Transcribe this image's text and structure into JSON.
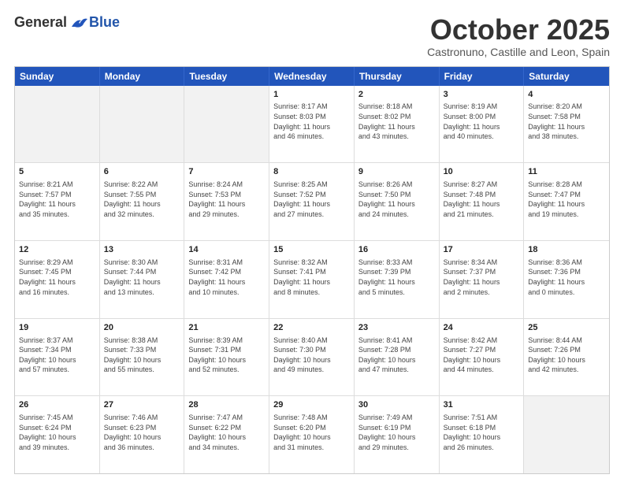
{
  "logo": {
    "general": "General",
    "blue": "Blue"
  },
  "header": {
    "month": "October 2025",
    "location": "Castronuno, Castille and Leon, Spain"
  },
  "days": [
    "Sunday",
    "Monday",
    "Tuesday",
    "Wednesday",
    "Thursday",
    "Friday",
    "Saturday"
  ],
  "rows": [
    [
      {
        "day": "",
        "info": ""
      },
      {
        "day": "",
        "info": ""
      },
      {
        "day": "",
        "info": ""
      },
      {
        "day": "1",
        "info": "Sunrise: 8:17 AM\nSunset: 8:03 PM\nDaylight: 11 hours\nand 46 minutes."
      },
      {
        "day": "2",
        "info": "Sunrise: 8:18 AM\nSunset: 8:02 PM\nDaylight: 11 hours\nand 43 minutes."
      },
      {
        "day": "3",
        "info": "Sunrise: 8:19 AM\nSunset: 8:00 PM\nDaylight: 11 hours\nand 40 minutes."
      },
      {
        "day": "4",
        "info": "Sunrise: 8:20 AM\nSunset: 7:58 PM\nDaylight: 11 hours\nand 38 minutes."
      }
    ],
    [
      {
        "day": "5",
        "info": "Sunrise: 8:21 AM\nSunset: 7:57 PM\nDaylight: 11 hours\nand 35 minutes."
      },
      {
        "day": "6",
        "info": "Sunrise: 8:22 AM\nSunset: 7:55 PM\nDaylight: 11 hours\nand 32 minutes."
      },
      {
        "day": "7",
        "info": "Sunrise: 8:24 AM\nSunset: 7:53 PM\nDaylight: 11 hours\nand 29 minutes."
      },
      {
        "day": "8",
        "info": "Sunrise: 8:25 AM\nSunset: 7:52 PM\nDaylight: 11 hours\nand 27 minutes."
      },
      {
        "day": "9",
        "info": "Sunrise: 8:26 AM\nSunset: 7:50 PM\nDaylight: 11 hours\nand 24 minutes."
      },
      {
        "day": "10",
        "info": "Sunrise: 8:27 AM\nSunset: 7:48 PM\nDaylight: 11 hours\nand 21 minutes."
      },
      {
        "day": "11",
        "info": "Sunrise: 8:28 AM\nSunset: 7:47 PM\nDaylight: 11 hours\nand 19 minutes."
      }
    ],
    [
      {
        "day": "12",
        "info": "Sunrise: 8:29 AM\nSunset: 7:45 PM\nDaylight: 11 hours\nand 16 minutes."
      },
      {
        "day": "13",
        "info": "Sunrise: 8:30 AM\nSunset: 7:44 PM\nDaylight: 11 hours\nand 13 minutes."
      },
      {
        "day": "14",
        "info": "Sunrise: 8:31 AM\nSunset: 7:42 PM\nDaylight: 11 hours\nand 10 minutes."
      },
      {
        "day": "15",
        "info": "Sunrise: 8:32 AM\nSunset: 7:41 PM\nDaylight: 11 hours\nand 8 minutes."
      },
      {
        "day": "16",
        "info": "Sunrise: 8:33 AM\nSunset: 7:39 PM\nDaylight: 11 hours\nand 5 minutes."
      },
      {
        "day": "17",
        "info": "Sunrise: 8:34 AM\nSunset: 7:37 PM\nDaylight: 11 hours\nand 2 minutes."
      },
      {
        "day": "18",
        "info": "Sunrise: 8:36 AM\nSunset: 7:36 PM\nDaylight: 11 hours\nand 0 minutes."
      }
    ],
    [
      {
        "day": "19",
        "info": "Sunrise: 8:37 AM\nSunset: 7:34 PM\nDaylight: 10 hours\nand 57 minutes."
      },
      {
        "day": "20",
        "info": "Sunrise: 8:38 AM\nSunset: 7:33 PM\nDaylight: 10 hours\nand 55 minutes."
      },
      {
        "day": "21",
        "info": "Sunrise: 8:39 AM\nSunset: 7:31 PM\nDaylight: 10 hours\nand 52 minutes."
      },
      {
        "day": "22",
        "info": "Sunrise: 8:40 AM\nSunset: 7:30 PM\nDaylight: 10 hours\nand 49 minutes."
      },
      {
        "day": "23",
        "info": "Sunrise: 8:41 AM\nSunset: 7:28 PM\nDaylight: 10 hours\nand 47 minutes."
      },
      {
        "day": "24",
        "info": "Sunrise: 8:42 AM\nSunset: 7:27 PM\nDaylight: 10 hours\nand 44 minutes."
      },
      {
        "day": "25",
        "info": "Sunrise: 8:44 AM\nSunset: 7:26 PM\nDaylight: 10 hours\nand 42 minutes."
      }
    ],
    [
      {
        "day": "26",
        "info": "Sunrise: 7:45 AM\nSunset: 6:24 PM\nDaylight: 10 hours\nand 39 minutes."
      },
      {
        "day": "27",
        "info": "Sunrise: 7:46 AM\nSunset: 6:23 PM\nDaylight: 10 hours\nand 36 minutes."
      },
      {
        "day": "28",
        "info": "Sunrise: 7:47 AM\nSunset: 6:22 PM\nDaylight: 10 hours\nand 34 minutes."
      },
      {
        "day": "29",
        "info": "Sunrise: 7:48 AM\nSunset: 6:20 PM\nDaylight: 10 hours\nand 31 minutes."
      },
      {
        "day": "30",
        "info": "Sunrise: 7:49 AM\nSunset: 6:19 PM\nDaylight: 10 hours\nand 29 minutes."
      },
      {
        "day": "31",
        "info": "Sunrise: 7:51 AM\nSunset: 6:18 PM\nDaylight: 10 hours\nand 26 minutes."
      },
      {
        "day": "",
        "info": ""
      }
    ]
  ]
}
